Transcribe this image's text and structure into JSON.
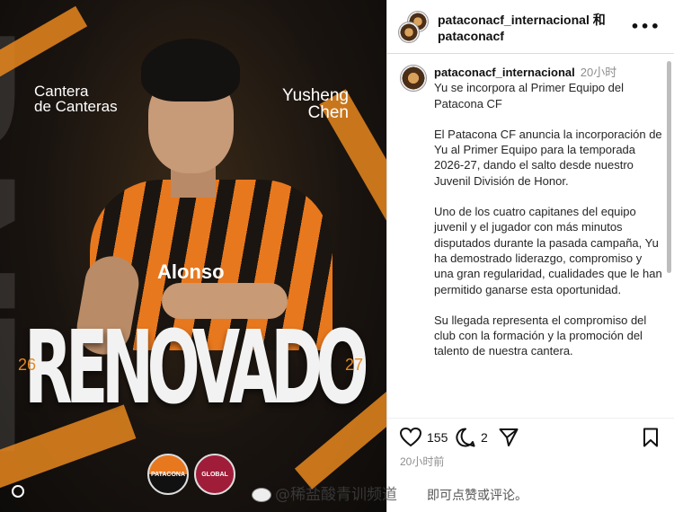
{
  "poster": {
    "left_label": "Cantera\nde Canteras",
    "right_label": "Yusheng\nChen",
    "headline": "RENOVADO",
    "season_start": "26",
    "season_end": "27",
    "sponsor": "Alonso",
    "crest_a": "PATACONA",
    "crest_b": "GLOBAL"
  },
  "header": {
    "title": "pataconacf_internacional 和 pataconacf",
    "more": "•••"
  },
  "caption": {
    "user": "pataconacf_internacional",
    "time": "20小时",
    "paragraphs": [
      "Yu se incorpora al Primer Equipo del Patacona CF",
      "El Patacona CF anuncia la incorporación de Yu al Primer Equipo para la temporada 2026-27, dando el salto desde nuestro Juvenil División de Honor.",
      "Uno de los cuatro capitanes del equipo juvenil y el jugador con más minutos disputados durante la pasada campaña, Yu ha demostrado liderazgo, compromiso y una gran regularidad, cualidades que le han permitido ganarse esta oportunidad.",
      "Su llegada representa el compromiso del club con la formación y la promoción del talento de nuestra cantera."
    ]
  },
  "actions": {
    "likes": "155",
    "comments": "2",
    "post_time": "20小时前"
  },
  "footer": {
    "note": "即可点赞或评论。",
    "watermark": "@稀盐酸青训频道"
  },
  "icons": {
    "like": "heart-icon",
    "comment": "comment-icon",
    "share": "send-icon",
    "save": "bookmark-icon"
  }
}
